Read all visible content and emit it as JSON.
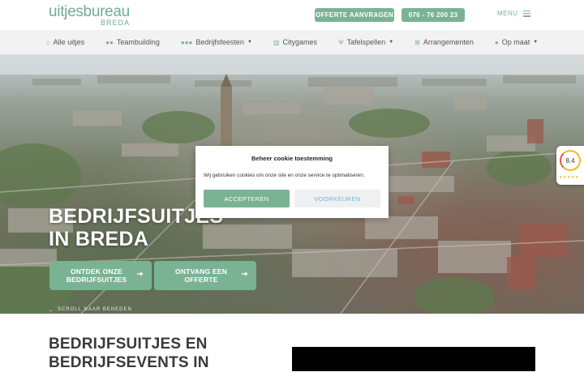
{
  "header": {
    "logo_main": "uitjesbureau",
    "logo_sub": "BREDA",
    "offerte_button": "OFFERTE AANVRAGEN",
    "phone_button": "076 - 76 200 23",
    "menu_label": "MENU"
  },
  "nav": {
    "items": [
      {
        "label": "Alle uitjes",
        "icon": "tag-icon",
        "dropdown": false
      },
      {
        "label": "Teambuilding",
        "icon": "users-icon",
        "dropdown": false
      },
      {
        "label": "Bedrijfsfeesten",
        "icon": "group-icon",
        "dropdown": true
      },
      {
        "label": "Citygames",
        "icon": "city-icon",
        "dropdown": false
      },
      {
        "label": "Tafelspellen",
        "icon": "cutlery-icon",
        "dropdown": true
      },
      {
        "label": "Arrangementen",
        "icon": "grid-icon",
        "dropdown": false
      },
      {
        "label": "Op maat",
        "icon": "bulb-icon",
        "dropdown": true
      }
    ]
  },
  "hero": {
    "title_line1": "BEDRIJFSUITJES",
    "title_line2": "IN BREDA",
    "button1_line1": "ONTDEK ONZE",
    "button1_line2": "BEDRIJFSUITJES",
    "button2_line1": "ONTVANG EEN",
    "button2_line2": "OFFERTE",
    "scroll_hint": "SCROLL NAAR BENEDEN"
  },
  "review": {
    "score": "8.4",
    "stars": "★★★★★"
  },
  "cookie": {
    "title": "Beheer cookie toestemming",
    "text": "Wij gebruiken cookies om onze site en onze service te optimaliseren.",
    "accept_label": "ACCEPTEREN",
    "prefs_label": "VOORKEUREN"
  },
  "below": {
    "title_line1": "BEDRIJFSUITJES EN",
    "title_line2": "BEDRIJFSEVENTS IN"
  },
  "colors": {
    "accent": "#79b394",
    "prefs_text": "#79b3d0",
    "star": "#f4b91f"
  }
}
